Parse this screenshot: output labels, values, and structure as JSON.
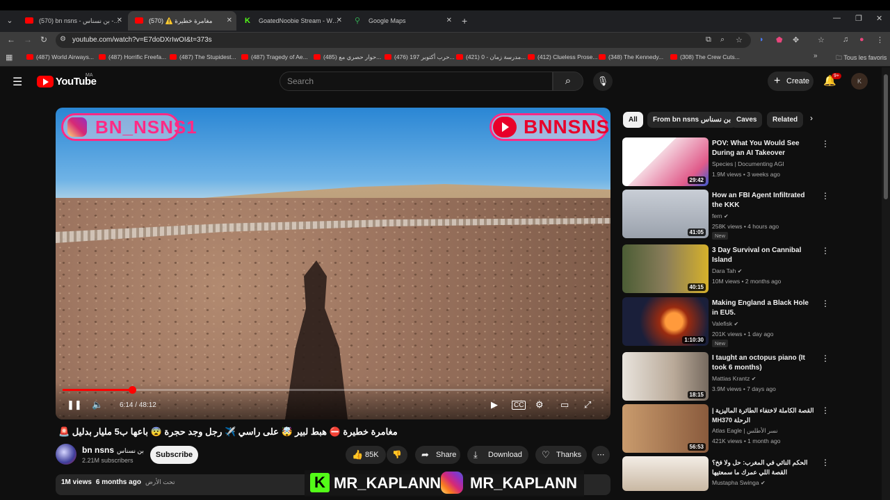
{
  "browser": {
    "tabs": [
      {
        "label": "(570) bn nsns - بن نسناس - YouTube"
      },
      {
        "label": "مغامرة خطيرة ⚠️ (570)"
      },
      {
        "label": "GoatedNoobie Stream - Watch"
      },
      {
        "label": "Google Maps"
      }
    ],
    "url": "youtube.com/watch?v=E7doDXrIwOI&t=373s",
    "bookmarks": [
      "(487) World Airways...",
      "(487) Horrific Freefa...",
      "(487) The Stupidest...",
      "(487) Tragedy of Ae...",
      "(485) حوار حصري مع...",
      "(476) حرب أكتوبر 197...",
      "(421) مدرسة زمان - 0...",
      "(412) Clueless Prose...",
      "(348) The Kennedy...",
      "(308) The Crew Cuts..."
    ],
    "bookmarks_folder": "Tous les favoris"
  },
  "header": {
    "logo_text": "YouTube",
    "region": "MA",
    "search_placeholder": "Search",
    "create_label": "Create",
    "notif_count": "9+",
    "avatar_letter": "K"
  },
  "player": {
    "overlay_left": "BN_NSNS1",
    "overlay_right": "BNNSNS",
    "time_current": "6:14",
    "time_total": "48:12",
    "progress": 0.129
  },
  "video": {
    "title": "مغامرة خطيرة ⛔ هبط لبير 🤯 على راسي ✈️ رجل وجد حجرة 😨 باعها ب5 مليار بدليل 🚨",
    "channel_name": "bn nsns",
    "channel_name_ar": "بن نسناس",
    "subscribers": "2.21M subscribers",
    "subscribe_label": "Subscribe",
    "likes": "85K",
    "share_label": "Share",
    "download_label": "Download",
    "thanks_label": "Thanks",
    "views": "1M views",
    "date": "6 months ago",
    "location": "تحت الأرض"
  },
  "watermark": {
    "left": "MR_KAPLANN",
    "right": "MR_KAPLANN"
  },
  "chips": [
    "All",
    "From bn nsns بن نسناس",
    "Caves",
    "Related"
  ],
  "recommendations": [
    {
      "title": "POV: What You Would See During an AI Takeover",
      "channel": "Species | Documenting AGI",
      "meta": "1.9M views • 3 weeks ago",
      "duration": "29:42",
      "new": ""
    },
    {
      "title": "How an FBI Agent Infiltrated the KKK",
      "channel": "fern",
      "meta": "258K views • 4 hours ago",
      "duration": "41:05",
      "new": "New"
    },
    {
      "title": "3 Day Survival on Cannibal Island",
      "channel": "Dara Tah",
      "meta": "10M views • 2 months ago",
      "duration": "40:15",
      "new": ""
    },
    {
      "title": "Making England a Black Hole in EU5.",
      "channel": "Valefisk",
      "meta": "201K views • 1 day ago",
      "duration": "1:10:30",
      "new": "New"
    },
    {
      "title": "I taught an octopus piano (It took 6 months)",
      "channel": "Mattias Krantz",
      "meta": "3.9M views • 7 days ago",
      "duration": "18:15",
      "new": ""
    },
    {
      "title": "القصة الكاملة لاختفاء الطائرة الماليزية | الرحلة MH370",
      "channel": "Atlas Eagle | نسر الأطلس",
      "meta": "421K views • 1 month ago",
      "duration": "56:53",
      "new": ""
    },
    {
      "title": "الحكم النائي في المغرب: حل ولا فخ؟ القصة اللي عمرك ما سمعتيها",
      "channel": "Mustapha Swinga",
      "meta": "",
      "duration": "",
      "new": ""
    }
  ]
}
